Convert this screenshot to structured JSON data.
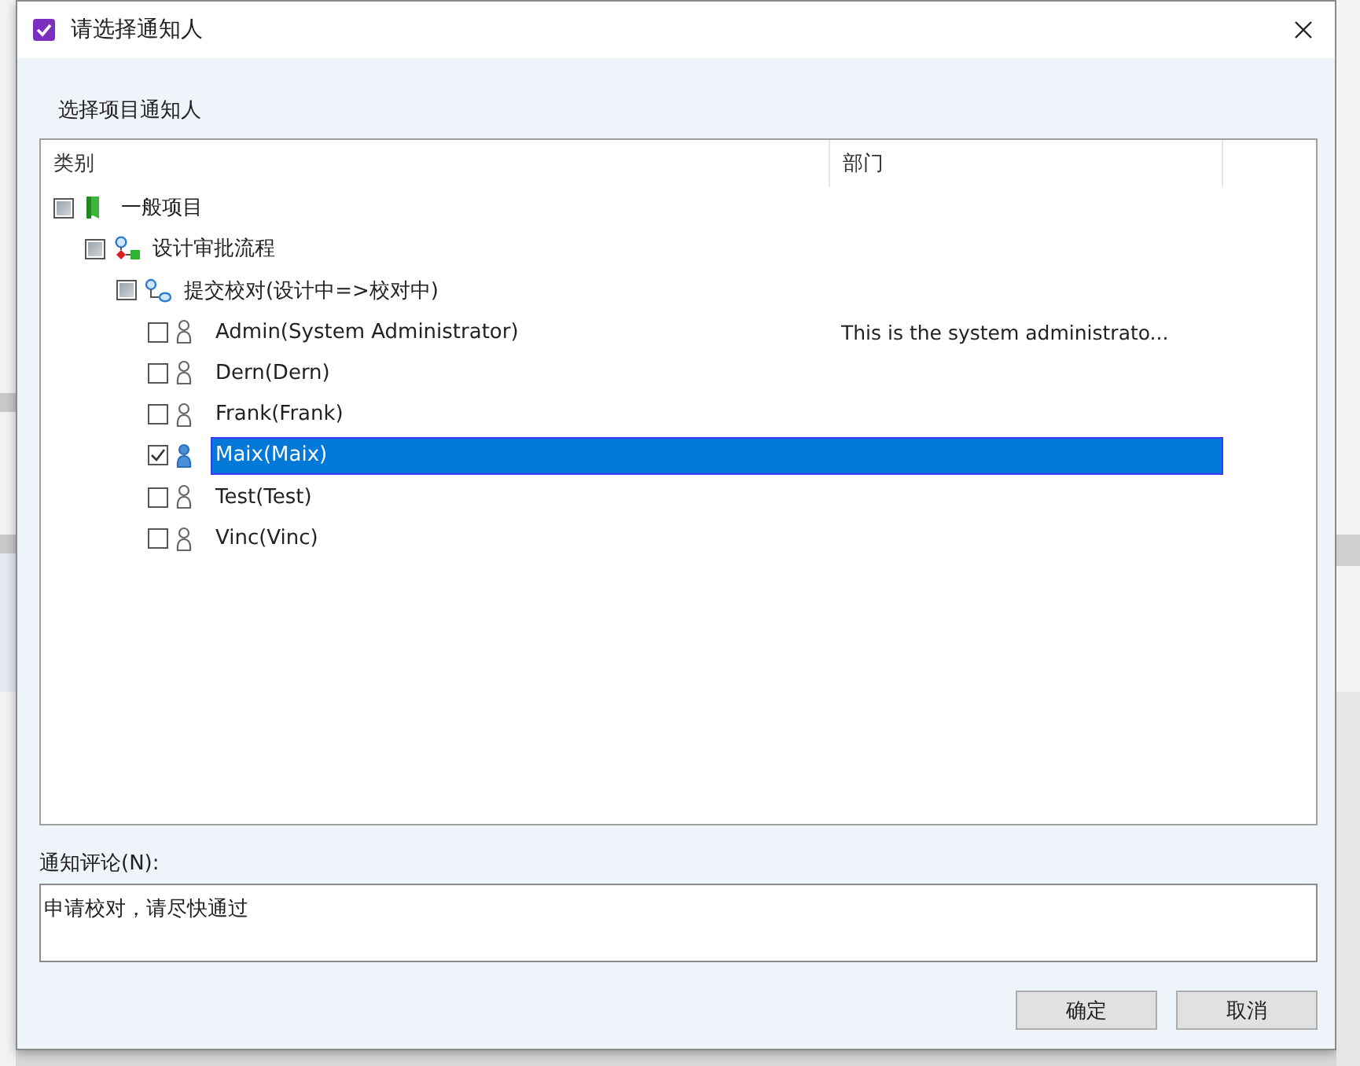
{
  "window": {
    "title": "请选择通知人"
  },
  "section_label": "选择项目通知人",
  "table": {
    "columns": [
      "类别",
      "部门"
    ]
  },
  "tree": [
    {
      "label": "一般项目",
      "kind": "project",
      "checked": false,
      "mixed": true,
      "selected": false,
      "children": [
        {
          "label": "设计审批流程",
          "kind": "workflow",
          "checked": false,
          "mixed": true,
          "selected": false,
          "children": [
            {
              "label": "提交校对(设计中=>校对中)",
              "kind": "step",
              "checked": false,
              "mixed": true,
              "selected": false,
              "children": [
                {
                  "label": "Admin(System Administrator)",
                  "kind": "user",
                  "department": "This is the system administrato...",
                  "checked": false,
                  "mixed": false,
                  "selected": false
                },
                {
                  "label": "Dern(Dern)",
                  "kind": "user",
                  "checked": false,
                  "mixed": false,
                  "selected": false
                },
                {
                  "label": "Frank(Frank)",
                  "kind": "user",
                  "checked": false,
                  "mixed": false,
                  "selected": false
                },
                {
                  "label": "Maix(Maix)",
                  "kind": "user",
                  "checked": true,
                  "mixed": false,
                  "selected": true
                },
                {
                  "label": "Test(Test)",
                  "kind": "user",
                  "checked": false,
                  "mixed": false,
                  "selected": false
                },
                {
                  "label": "Vinc(Vinc)",
                  "kind": "user",
                  "checked": false,
                  "mixed": false,
                  "selected": false
                }
              ]
            }
          ]
        }
      ]
    }
  ],
  "comment": {
    "label": "通知评论(N):",
    "value": "申请校对，请尽快通过"
  },
  "buttons": [
    "确定",
    "取消"
  ]
}
